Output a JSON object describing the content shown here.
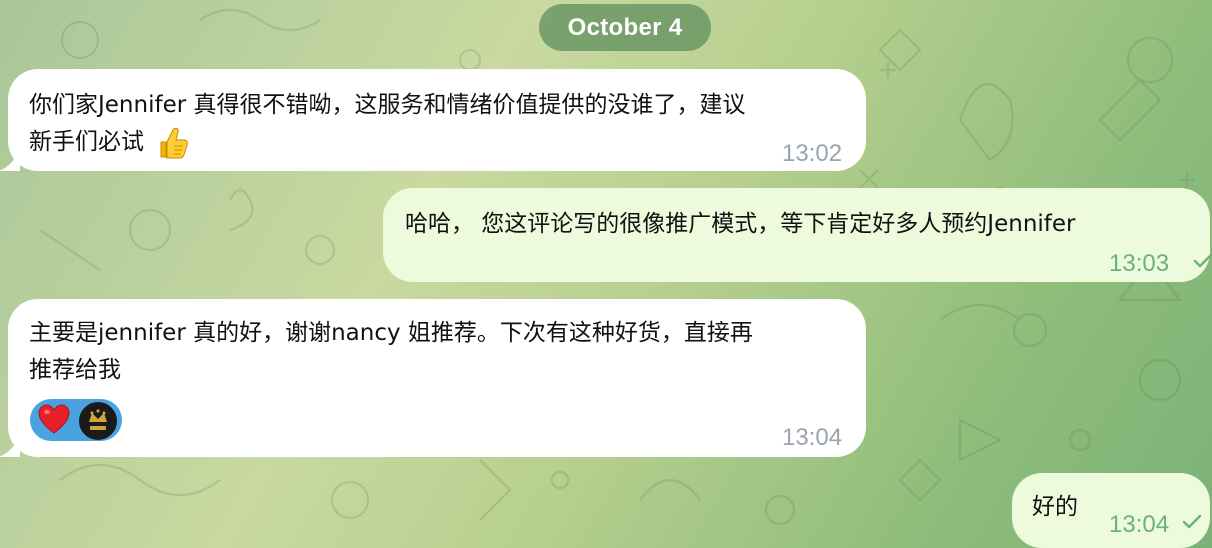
{
  "date_label": "October 4",
  "messages": [
    {
      "id": "msg1",
      "direction": "incoming",
      "lines": [
        "你们家Jennifer 真得很不错呦，这服务和情绪价值提供的没谁了，建议",
        "新手们必试"
      ],
      "emoji": "thumbs-up",
      "time": "13:02"
    },
    {
      "id": "msg2",
      "direction": "outgoing",
      "lines": [
        "哈哈， 您这评论写的很像推广模式，等下肯定好多人预约Jennifer"
      ],
      "time": "13:03",
      "status": "read-check"
    },
    {
      "id": "msg3",
      "direction": "incoming",
      "lines": [
        "主要是jennifer 真的好，谢谢nancy 姐推荐。下次有这种好货，直接再",
        "推荐给我"
      ],
      "reactions": [
        "red-heart-icon",
        "user-avatar"
      ],
      "time": "13:04"
    },
    {
      "id": "msg4",
      "direction": "outgoing",
      "lines": [
        "好的"
      ],
      "time": "13:04",
      "status": "read-check"
    }
  ],
  "colors": {
    "incoming_bubble": "#ffffff",
    "outgoing_bubble": "#eefadc",
    "time_incoming": "#9aa4ad",
    "time_outgoing": "#6ab27a",
    "reaction_pill": "#4aa3e0",
    "date_pill": "#5c8c5c"
  }
}
